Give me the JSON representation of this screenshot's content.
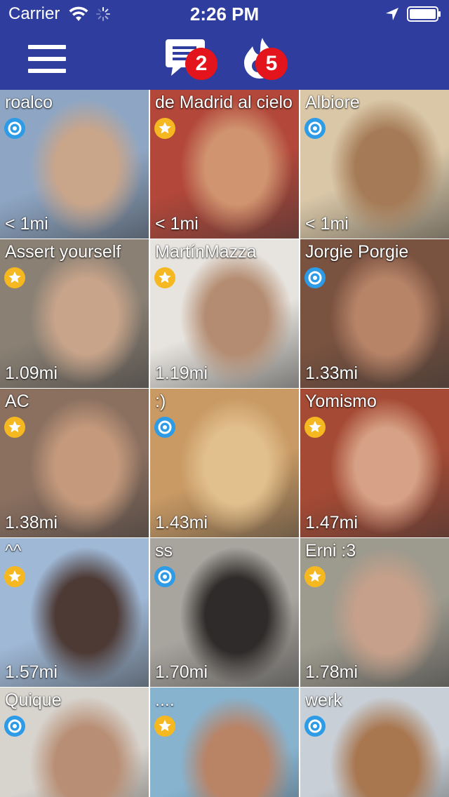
{
  "status_bar": {
    "carrier": "Carrier",
    "time": "2:26 PM"
  },
  "nav": {
    "menu_icon": "hamburger-menu-icon",
    "chat_icon": "chat-bubble-icon",
    "chat_badge": "2",
    "fire_icon": "flame-icon",
    "fire_badge": "5"
  },
  "colors": {
    "nav_bg": "#2f3d9e",
    "badge": "#e3141b",
    "online_blue": "#2e9be6",
    "favorite_yellow": "#f5b820"
  },
  "profiles": [
    {
      "name": "roalco",
      "distance": "< 1mi",
      "icon": "online-icon"
    },
    {
      "name": "de Madrid al cielo",
      "distance": "< 1mi",
      "icon": "star-icon"
    },
    {
      "name": "Albiore",
      "distance": "< 1mi",
      "icon": "online-icon"
    },
    {
      "name": "Assert yourself",
      "distance": "1.09mi",
      "icon": "star-icon"
    },
    {
      "name": "MartínMazza",
      "distance": "1.19mi",
      "icon": "star-icon"
    },
    {
      "name": "Jorgie Porgie",
      "distance": "1.33mi",
      "icon": "online-icon"
    },
    {
      "name": "AC",
      "distance": "1.38mi",
      "icon": "star-icon"
    },
    {
      "name": ":)",
      "distance": "1.43mi",
      "icon": "online-icon"
    },
    {
      "name": "Yomismo",
      "distance": "1.47mi",
      "icon": "star-icon"
    },
    {
      "name": "^^",
      "distance": "1.57mi",
      "icon": "star-icon"
    },
    {
      "name": "ss",
      "distance": "1.70mi",
      "icon": "online-icon"
    },
    {
      "name": "Erni :3",
      "distance": "1.78mi",
      "icon": "star-icon"
    },
    {
      "name": "Quique",
      "distance": "",
      "icon": "online-icon"
    },
    {
      "name": "....",
      "distance": "",
      "icon": "star-icon"
    },
    {
      "name": "werk",
      "distance": "",
      "icon": "online-icon"
    }
  ]
}
